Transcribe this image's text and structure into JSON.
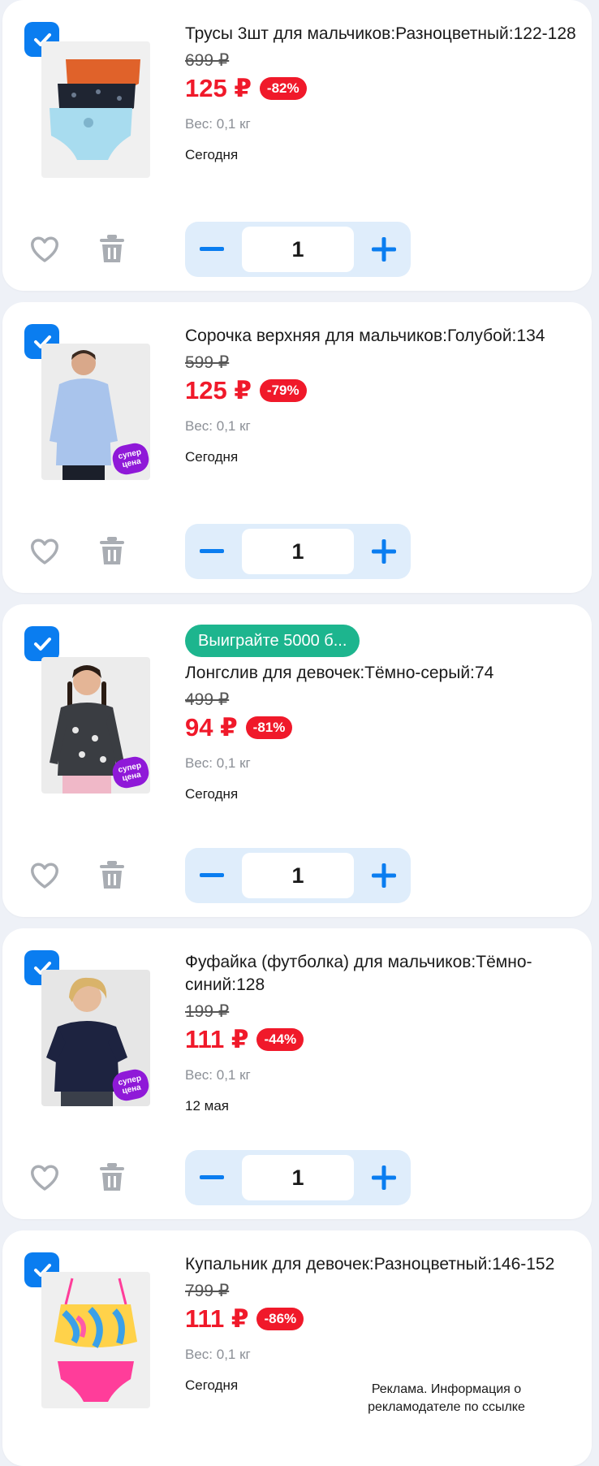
{
  "items": [
    {
      "title": "Трусы 3шт для мальчиков:Разноцветный:122-128",
      "promo": "",
      "old_price": "699 ₽",
      "price": "125 ₽",
      "discount": "-82%",
      "weight": "Вес: 0,1 кг",
      "delivery": "Сегодня",
      "quantity": "1",
      "super_badge": ""
    },
    {
      "title": "Сорочка верхняя для мальчиков:Голубой:134",
      "promo": "",
      "old_price": "599 ₽",
      "price": "125 ₽",
      "discount": "-79%",
      "weight": "Вес: 0,1 кг",
      "delivery": "Сегодня",
      "quantity": "1",
      "super_badge": "супер цена"
    },
    {
      "title": "Лонгслив для девочек:Тёмно-серый:74",
      "promo": "Выиграйте 5000 б...",
      "old_price": "499 ₽",
      "price": "94 ₽",
      "discount": "-81%",
      "weight": "Вес: 0,1 кг",
      "delivery": "Сегодня",
      "quantity": "1",
      "super_badge": "супер цена"
    },
    {
      "title": "Фуфайка (футболка) для мальчиков:Тёмно-синий:128",
      "promo": "",
      "old_price": "199 ₽",
      "price": "111 ₽",
      "discount": "-44%",
      "weight": "Вес: 0,1 кг",
      "delivery": "12 мая",
      "quantity": "1",
      "super_badge": "супер цена"
    },
    {
      "title": "Купальник для девочек:Разноцветный:146-152",
      "promo": "",
      "old_price": "799 ₽",
      "price": "111 ₽",
      "discount": "-86%",
      "weight": "Вес: 0,1 кг",
      "delivery": "Сегодня",
      "quantity": "",
      "super_badge": ""
    }
  ],
  "ad_note": "Реклама. Информация о рекламодателе по ссылке",
  "colors": {
    "accent_blue": "#0a7df0",
    "price_red": "#f0192a",
    "promo_green": "#1db58e",
    "super_purple": "#8f19d8",
    "stepper_bg": "#dfedfb"
  },
  "icons": [
    "checkbox-checked-icon",
    "heart-icon",
    "trash-icon",
    "minus-icon",
    "plus-icon"
  ]
}
